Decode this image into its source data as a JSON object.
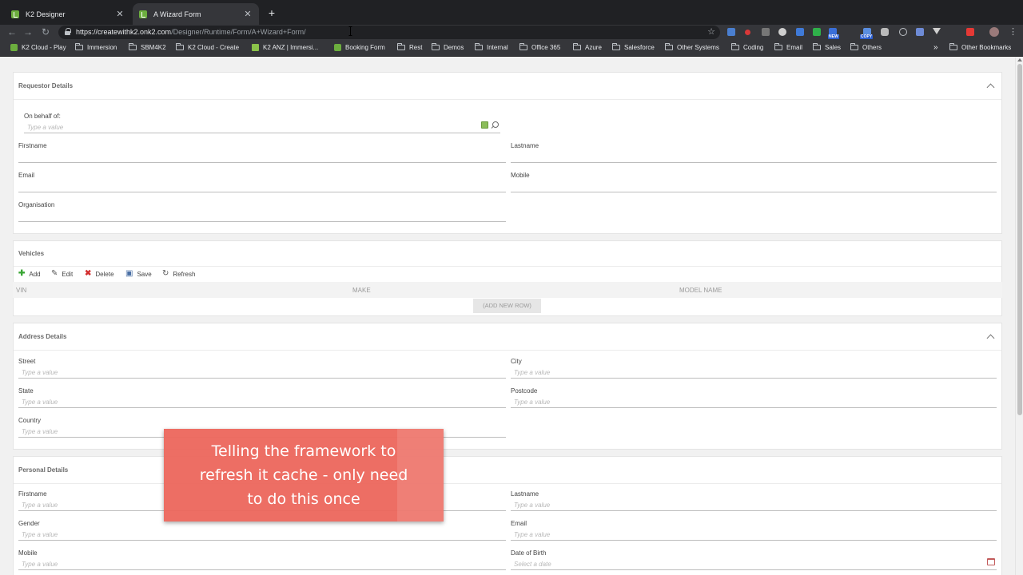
{
  "browser": {
    "tabs": [
      {
        "title": "K2 Designer",
        "close": "✕"
      },
      {
        "title": "A Wizard Form",
        "close": "✕"
      }
    ],
    "new_tab": "+",
    "nav": {
      "back": "←",
      "forward": "→",
      "reload": "↻"
    },
    "url_host": "https://createwithk2.onk2.com",
    "url_path": "/Designer/Runtime/Form/A+Wizard+Form/",
    "bookmark_star": "☆",
    "menu": "⋮",
    "ext_badges": {
      "new": "NEW",
      "copy": "COPY"
    },
    "bookmarks": [
      "K2 Cloud - Play",
      "Immersion",
      "SBM4K2",
      "K2 Cloud - Create",
      "K2 ANZ | Immersi...",
      "Booking Form",
      "Rest",
      "Demos",
      "Internal",
      "Office 365",
      "Azure",
      "Salesforce",
      "Other Systems",
      "Coding",
      "Email",
      "Sales",
      "Others"
    ],
    "bookmarks_more": "»",
    "other_bookmarks": "Other Bookmarks"
  },
  "form": {
    "requestor": {
      "title": "Requestor Details",
      "on_behalf_label": "On behalf of:",
      "on_behalf_placeholder": "Type a value",
      "firstname": "Firstname",
      "lastname": "Lastname",
      "email": "Email",
      "mobile": "Mobile",
      "organisation": "Organisation"
    },
    "vehicles": {
      "title": "Vehicles",
      "toolbar": {
        "add": "Add",
        "edit": "Edit",
        "delete": "Delete",
        "save": "Save",
        "refresh": "Refresh"
      },
      "columns": [
        "VIN",
        "MAKE",
        "MODEL NAME"
      ],
      "add_row": "(ADD NEW ROW)"
    },
    "address": {
      "title": "Address Details",
      "street": "Street",
      "city": "City",
      "state": "State",
      "postcode": "Postcode",
      "country": "Country",
      "placeholder": "Type a value"
    },
    "personal": {
      "title": "Personal Details",
      "firstname": "Firstname",
      "lastname": "Lastname",
      "gender": "Gender",
      "email": "Email",
      "mobile": "Mobile",
      "dob": "Date of Birth",
      "placeholder": "Type a value",
      "date_placeholder": "Select a date"
    }
  },
  "overlay": {
    "text": "Telling the framework to refresh it cache - only need to do this once"
  },
  "colors": {
    "chrome_dark": "#202124",
    "chrome_toolbar": "#35363a",
    "k2_green": "#6cae3e",
    "overlay": "#ec665c"
  }
}
